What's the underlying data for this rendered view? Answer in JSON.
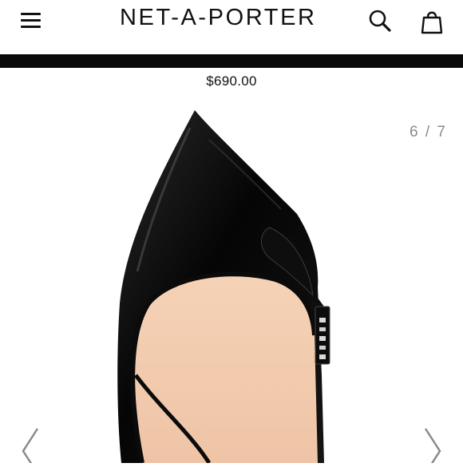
{
  "header": {
    "logo_text": "NET-A-PORTER",
    "menu_icon": "hamburger-menu-icon",
    "search_icon": "search-icon",
    "bag_icon": "shopping-bag-icon"
  },
  "product": {
    "price": "$690.00",
    "image_subject": "pointed-toe-pump",
    "counter": "6 / 7"
  },
  "gallery": {
    "prev_icon": "chevron-left-icon",
    "next_icon": "chevron-right-icon"
  },
  "colors": {
    "bar": "#0a0a0a",
    "counter_text": "#8a8a8a",
    "lining": "#f3cdb0"
  }
}
